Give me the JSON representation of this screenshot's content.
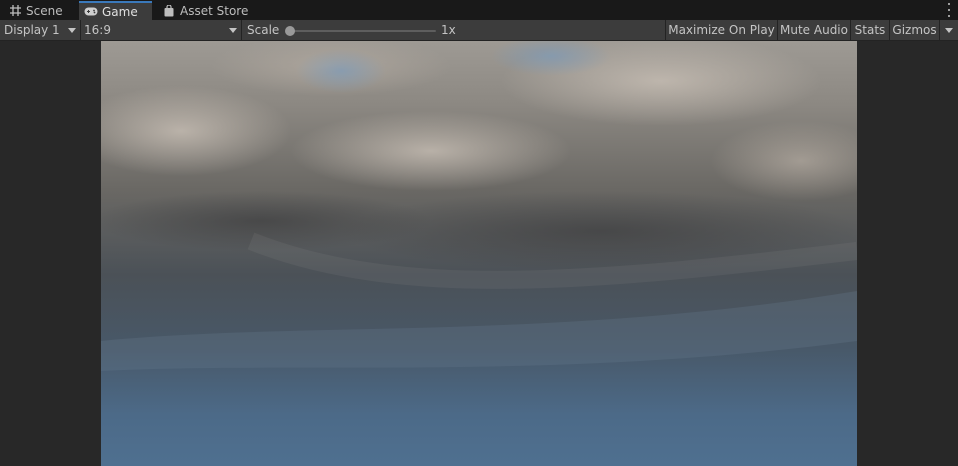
{
  "tabs": [
    {
      "label": "Scene",
      "icon": "grid-icon",
      "active": false
    },
    {
      "label": "Game",
      "icon": "gamepad-icon",
      "active": true
    },
    {
      "label": "Asset Store",
      "icon": "shopping-bag-icon",
      "active": false
    }
  ],
  "toolbar": {
    "display": "Display 1",
    "aspect": "16:9",
    "scale_label": "Scale",
    "scale_value": "1x",
    "maximize_on_play": "Maximize On Play",
    "mute_audio": "Mute Audio",
    "stats": "Stats",
    "gizmos": "Gizmos"
  },
  "colors": {
    "accent": "#3a79bb",
    "panel": "#3c3c3c",
    "background": "#282828"
  }
}
